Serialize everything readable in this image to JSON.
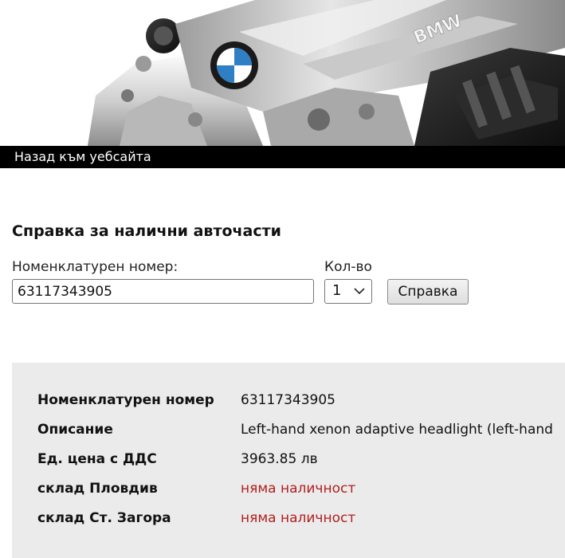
{
  "back_link": "Назад към уебсайта",
  "form": {
    "title": "Справка за налични авточасти",
    "part_label": "Номенклатурен номер:",
    "part_value": "63117343905",
    "qty_label": "Кол-во",
    "qty_value": "1",
    "submit_label": "Справка"
  },
  "results": {
    "rows": [
      {
        "label": "Номенклатурен номер",
        "value": "63117343905",
        "status": "normal"
      },
      {
        "label": "Описание",
        "value": "Left-hand xenon adaptive headlight (left-hand",
        "status": "normal"
      },
      {
        "label": "Ед. цена с ДДС",
        "value": "3963.85 лв",
        "status": "normal"
      },
      {
        "label": "склад Пловдив",
        "value": "няма наличност",
        "status": "unavailable"
      },
      {
        "label": "склад Ст. Загора",
        "value": "няма наличност",
        "status": "unavailable"
      }
    ]
  },
  "banner": {
    "logo_text": "BMW",
    "engine_cover_text": "BMW"
  },
  "colors": {
    "unavailable": "#b21f1f",
    "results_bg": "#ebebeb",
    "back_bar": "#000000"
  }
}
